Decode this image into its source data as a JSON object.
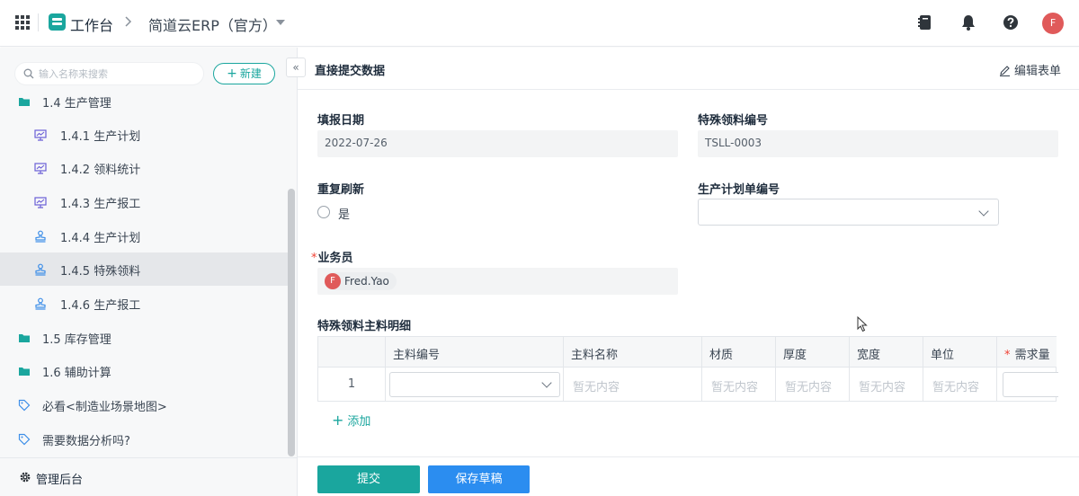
{
  "header": {
    "workspace_label": "工作台",
    "separator": ">",
    "app_name": "简道云ERP（官方）",
    "avatar_letter": "F",
    "accent_color": "#1aa69e"
  },
  "sidebar": {
    "search_placeholder": "输入名称来搜索",
    "new_button": "新建",
    "collapse_glyph": "«",
    "items": [
      {
        "label": "1.4 生产管理",
        "icon": "folder-icon"
      },
      {
        "label": "1.4.1 生产计划",
        "icon": "dashboard-icon"
      },
      {
        "label": "1.4.2 领料统计",
        "icon": "dashboard-icon"
      },
      {
        "label": "1.4.3 生产报工",
        "icon": "dashboard-icon"
      },
      {
        "label": "1.4.4 生产计划",
        "icon": "form-stamp-icon"
      },
      {
        "label": "1.4.5 特殊领料",
        "icon": "form-stamp-icon",
        "active": true
      },
      {
        "label": "1.4.6 生产报工",
        "icon": "form-stamp-icon"
      },
      {
        "label": "1.5 库存管理",
        "icon": "folder-icon"
      },
      {
        "label": "1.6 辅助计算",
        "icon": "folder-icon"
      },
      {
        "label": "必看<制造业场景地图>",
        "icon": "tag-icon"
      },
      {
        "label": "需要数据分析吗?",
        "icon": "tag-icon"
      }
    ],
    "admin_label": "管理后台"
  },
  "form": {
    "title": "直接提交数据",
    "edit_link": "编辑表单",
    "fields": {
      "report_date": {
        "label": "填报日期",
        "value": "2022-07-26"
      },
      "special_no": {
        "label": "特殊领料编号",
        "value": "TSLL-0003"
      },
      "repeat_refresh": {
        "label": "重复刷新",
        "option": "是"
      },
      "plan_no": {
        "label": "生产计划单编号",
        "value": ""
      },
      "salesman": {
        "label": "业务员",
        "required_mark": "*",
        "value": "Fred.Yao",
        "avatar_letter": "F"
      }
    },
    "detail": {
      "title": "特殊领料主料明细",
      "columns": [
        "",
        "主料编号",
        "主料名称",
        "材质",
        "厚度",
        "宽度",
        "单位",
        "需求量"
      ],
      "required_mark": "*",
      "rows": [
        {
          "index": "1",
          "empty_text": "暂无内容"
        }
      ],
      "add_label": "添加"
    },
    "buttons": {
      "submit": "提交",
      "save_draft": "保存草稿"
    }
  }
}
